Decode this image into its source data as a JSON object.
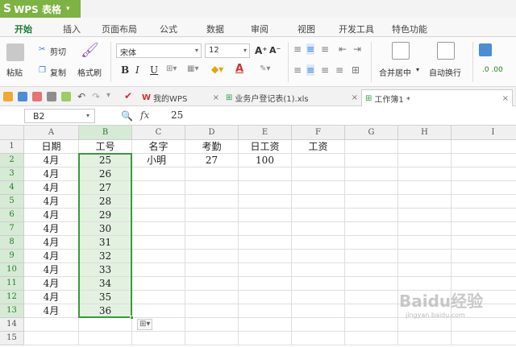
{
  "app": {
    "title": "WPS 表格"
  },
  "menu": {
    "tabs": [
      "开始",
      "插入",
      "页面布局",
      "公式",
      "数据",
      "审阅",
      "视图",
      "开发工具",
      "特色功能"
    ]
  },
  "ribbon": {
    "paste": "粘贴",
    "cut": "剪切",
    "copy": "复制",
    "format_painter": "格式刷",
    "font_name": "宋体",
    "font_size": "12",
    "bold": "B",
    "italic": "I",
    "underline": "U",
    "merge_center": "合并居中",
    "wrap_text": "自动换行"
  },
  "doc_tabs": [
    {
      "label": "我的WPS"
    },
    {
      "label": "业务户登记表(1).xls"
    },
    {
      "label": "工作簿1 *"
    }
  ],
  "formula": {
    "cell_ref": "B2",
    "fx": "fx",
    "value": "25"
  },
  "columns": [
    "A",
    "B",
    "C",
    "D",
    "E",
    "F",
    "G",
    "H",
    "I"
  ],
  "rows": [
    "1",
    "2",
    "3",
    "4",
    "5",
    "6",
    "7",
    "8",
    "9",
    "10",
    "11",
    "12",
    "13",
    "14",
    "15"
  ],
  "cells": {
    "A1": "日期",
    "B1": "工号",
    "C1": "名字",
    "D1": "考勤",
    "E1": "日工资",
    "F1": "工资",
    "A2": "4月",
    "B2": "25",
    "C2": "小明",
    "D2": "27",
    "E2": "100",
    "A3": "4月",
    "B3": "26",
    "A4": "4月",
    "B4": "27",
    "A5": "4月",
    "B5": "28",
    "A6": "4月",
    "B6": "29",
    "A7": "4月",
    "B7": "30",
    "A8": "4月",
    "B8": "31",
    "A9": "4月",
    "B9": "32",
    "A10": "4月",
    "B10": "33",
    "A11": "4月",
    "B11": "34",
    "A12": "4月",
    "B12": "35",
    "A13": "4月",
    "B13": "36"
  },
  "selection": "B2:B13",
  "watermark": {
    "main": "Baidu经验",
    "sub": "jingyan.baidu.com"
  },
  "colors": {
    "brand": "#7cb342",
    "selection": "#3a9a3a"
  }
}
